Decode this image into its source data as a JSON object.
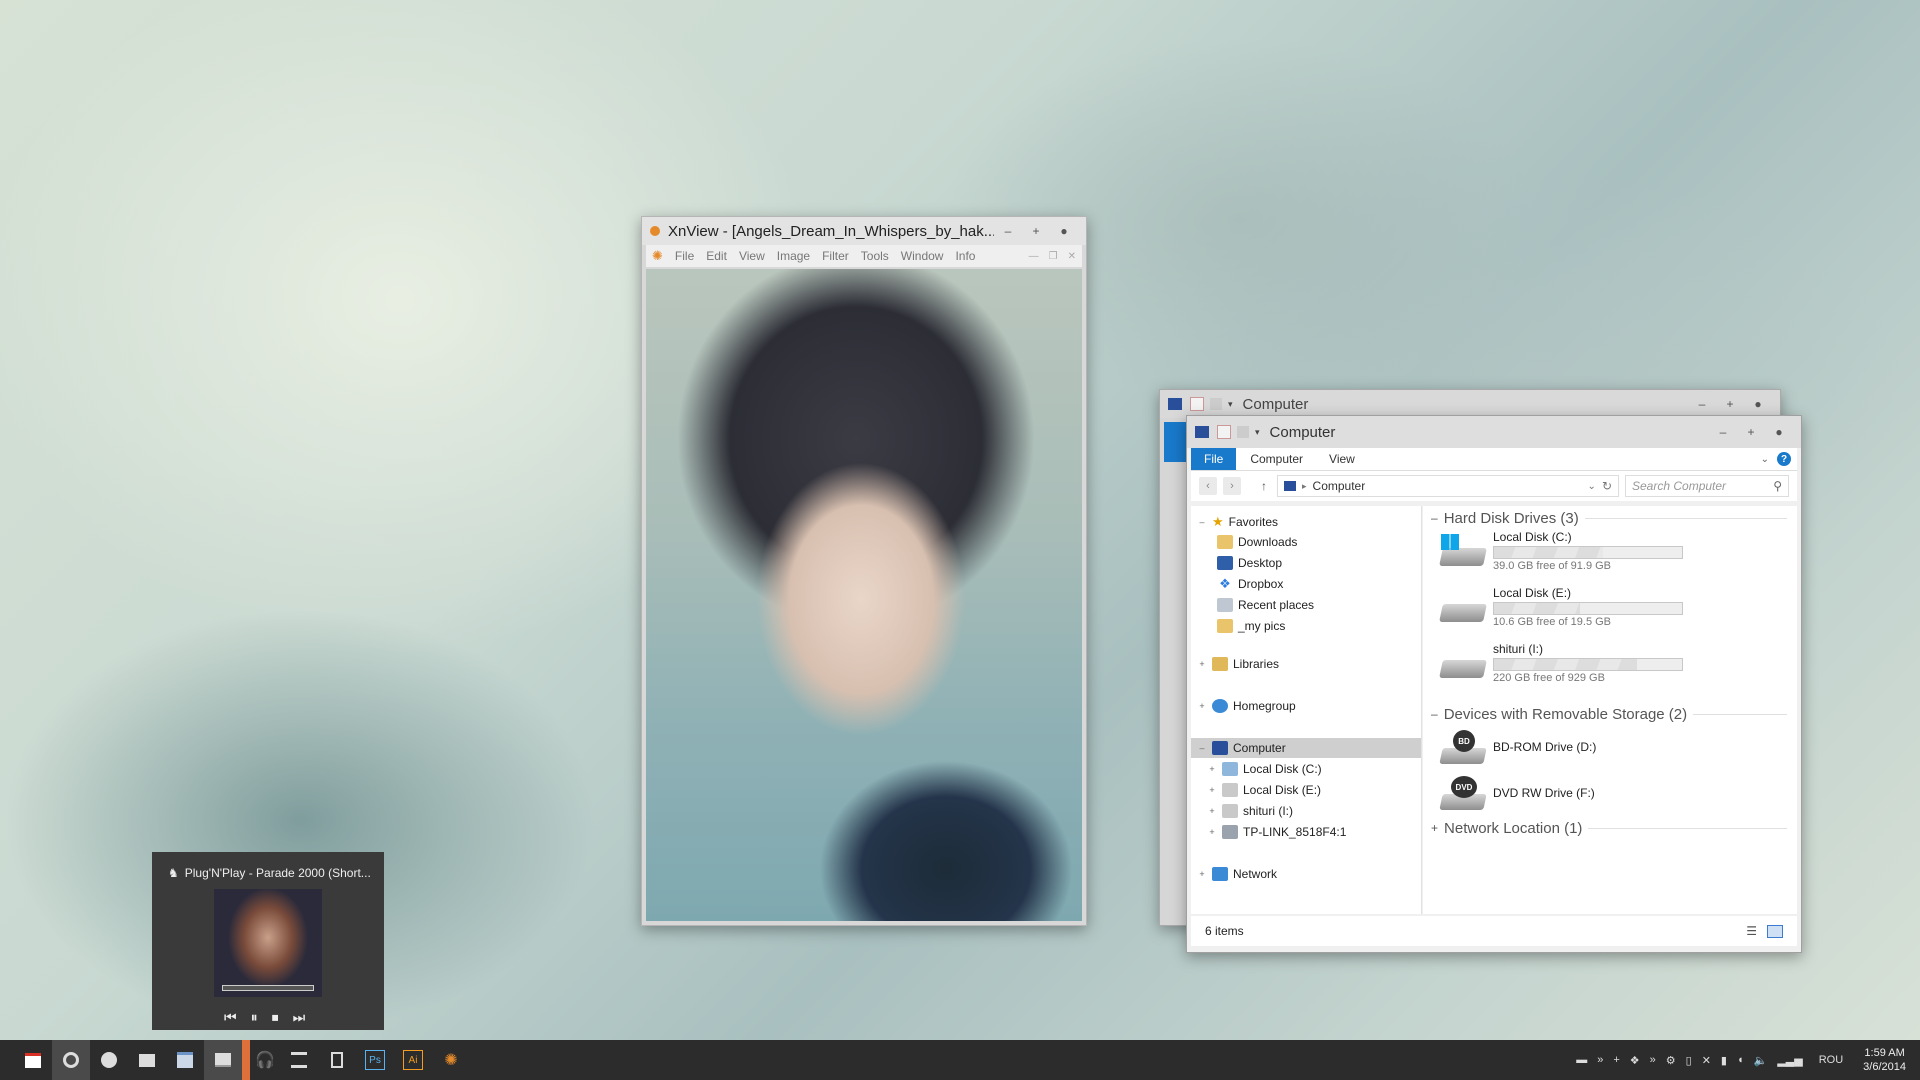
{
  "xnview": {
    "title": "XnView - [Angels_Dream_In_Whispers_by_hak...",
    "menu": [
      "File",
      "Edit",
      "View",
      "Image",
      "Filter",
      "Tools",
      "Window",
      "Info"
    ],
    "btn_min": "–",
    "btn_max": "+",
    "btn_close": "●"
  },
  "explorer_back": {
    "title": "Computer"
  },
  "explorer": {
    "title": "Computer",
    "tabs": {
      "file": "File",
      "computer": "Computer",
      "view": "View"
    },
    "help": "?",
    "address": "Computer",
    "search_placeholder": "Search Computer",
    "nav": {
      "favorites": "Favorites",
      "downloads": "Downloads",
      "desktop": "Desktop",
      "dropbox": "Dropbox",
      "recent": "Recent places",
      "mypics": "_my pics",
      "libraries": "Libraries",
      "homegroup": "Homegroup",
      "computer": "Computer",
      "localc": "Local Disk (C:)",
      "locale": "Local Disk (E:)",
      "shituri": "shituri (I:)",
      "tplink": "TP-LINK_8518F4:1",
      "network": "Network"
    },
    "groups": {
      "hdd": "Hard Disk Drives (3)",
      "removable": "Devices with Removable Storage (2)",
      "network": "Network Location (1)"
    },
    "drives": [
      {
        "name": "Local Disk (C:)",
        "free": "39.0 GB free of 91.9 GB",
        "used_fraction": 0.58
      },
      {
        "name": "Local Disk (E:)",
        "free": "10.6 GB free of 19.5 GB",
        "used_fraction": 0.46
      },
      {
        "name": "shituri (I:)",
        "free": "220 GB free of 929 GB",
        "used_fraction": 0.76
      }
    ],
    "removable": [
      {
        "name": "BD-ROM Drive (D:)",
        "badge": "BD"
      },
      {
        "name": "DVD RW Drive (F:)",
        "badge": "DVD"
      }
    ],
    "status": "6 items"
  },
  "music": {
    "track": "Plug'N'Play - Parade 2000 (Short...",
    "prev": "⏮",
    "pause": "⏸",
    "stop": "⏹",
    "next": "⏭"
  },
  "taskbar": {
    "ps_label": "Ps",
    "ai_label": "Ai",
    "language": "ROU",
    "time": "1:59 AM",
    "date": "3/6/2014"
  },
  "colors": {
    "accent_blue": "#1979ca",
    "taskbar": "#2c2c2c",
    "taskbar_marker": "#e0703a"
  }
}
